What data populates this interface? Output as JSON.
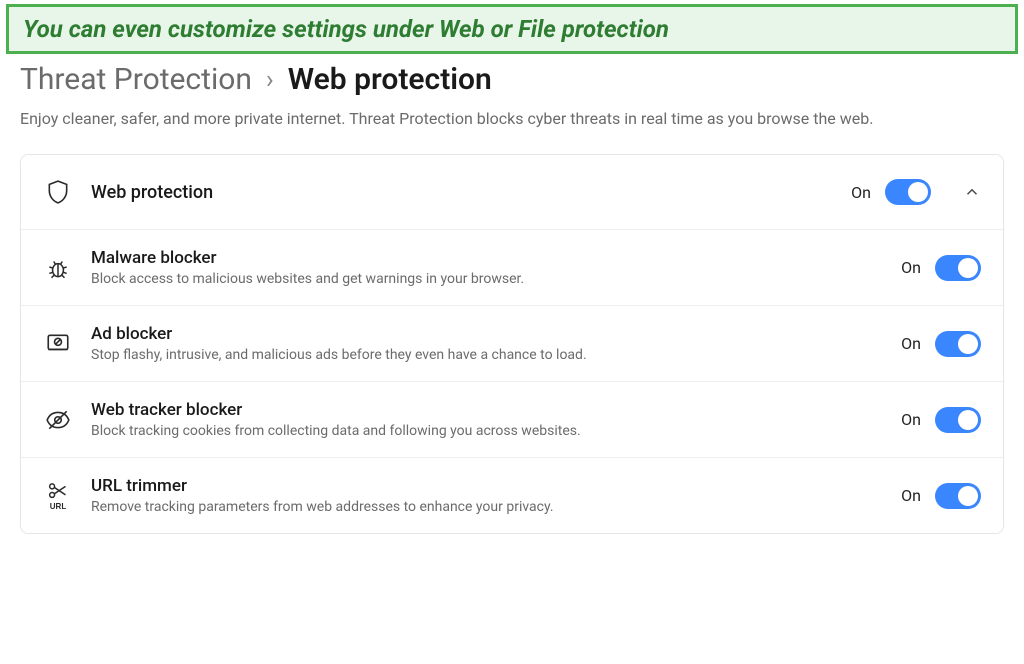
{
  "banner": {
    "text": "You can even customize settings under Web or File protection"
  },
  "breadcrumb": {
    "parent": "Threat Protection",
    "separator": "›",
    "current": "Web protection"
  },
  "description": "Enjoy cleaner, safer, and more private internet. Threat Protection blocks cyber threats in real time as you browse the web.",
  "header": {
    "title": "Web protection",
    "state": "On",
    "icon": "shield-icon",
    "expanded": true
  },
  "items": [
    {
      "icon": "bug-icon",
      "title": "Malware blocker",
      "desc": "Block access to malicious websites and get warnings in your browser.",
      "state": "On"
    },
    {
      "icon": "monitor-block-icon",
      "title": "Ad blocker",
      "desc": "Stop flashy, intrusive, and malicious ads before they even have a chance to load.",
      "state": "On"
    },
    {
      "icon": "eye-off-icon",
      "title": "Web tracker blocker",
      "desc": "Block tracking cookies from collecting data and following you across websites.",
      "state": "On"
    },
    {
      "icon": "scissors-url-icon",
      "title": "URL trimmer",
      "desc": "Remove tracking parameters from web addresses to enhance your privacy.",
      "state": "On"
    }
  ],
  "colors": {
    "accent": "#3a86ff",
    "banner_bg": "#e8f5e9",
    "banner_border": "#4caf50",
    "banner_text": "#2e7d32"
  }
}
